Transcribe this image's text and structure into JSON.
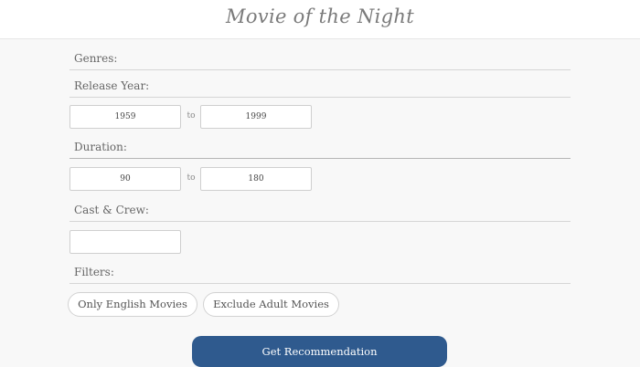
{
  "header": {
    "title": "Movie of the Night"
  },
  "form": {
    "genres_label": "Genres:",
    "release_year": {
      "label": "Release Year:",
      "from_value": "1959",
      "to_label": "to",
      "to_value": "1999"
    },
    "duration": {
      "label": "Duration:",
      "from_value": "90",
      "to_label": "to",
      "to_value": "180"
    },
    "cast_crew": {
      "label": "Cast & Crew:",
      "value": ""
    },
    "filters": {
      "label": "Filters:",
      "only_english": "Only English Movies",
      "exclude_adult": "Exclude Adult Movies"
    },
    "submit_label": "Get Recommendation"
  },
  "colors": {
    "primary": "#2f5a8e",
    "background": "#f8f8f8"
  }
}
